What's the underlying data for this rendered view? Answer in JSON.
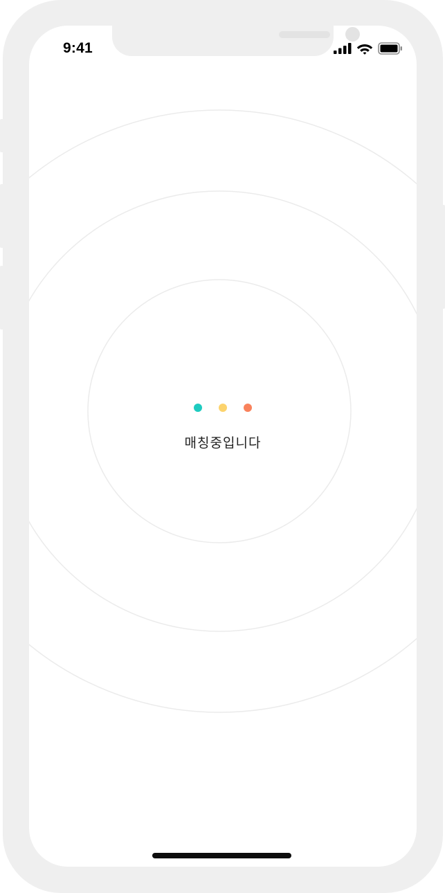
{
  "status_bar": {
    "time": "9:41",
    "signal_icon": "cellular-signal-icon",
    "wifi_icon": "wifi-icon",
    "battery_icon": "battery-icon"
  },
  "matching": {
    "dots": [
      {
        "color": "#1ecbc0"
      },
      {
        "color": "#fcd36d"
      },
      {
        "color": "#f9825c"
      }
    ],
    "message": "매칭중입니다"
  },
  "colors": {
    "frame": "#efefef",
    "ring_stroke": "#ebebeb",
    "text": "#222222"
  }
}
